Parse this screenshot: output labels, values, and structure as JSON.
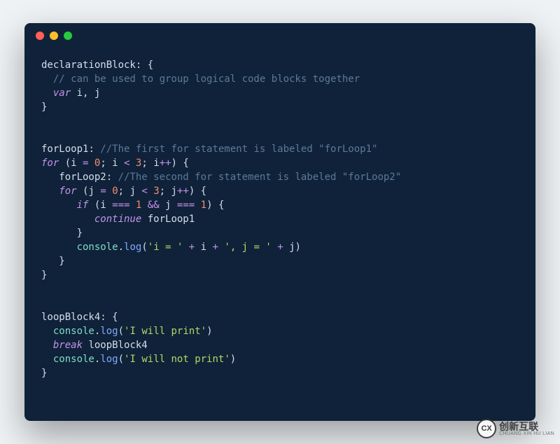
{
  "window": {
    "trafficLights": {
      "red": "#ff5f56",
      "yellow": "#ffbd2e",
      "green": "#27c93f"
    }
  },
  "code": {
    "lines": [
      [
        {
          "t": "declarationBlock",
          "c": "c-label"
        },
        {
          "t": ": {",
          "c": "c-punct"
        }
      ],
      [
        {
          "t": "  ",
          "c": "c-default"
        },
        {
          "t": "// can be used to group logical code blocks together",
          "c": "c-comment"
        }
      ],
      [
        {
          "t": "  ",
          "c": "c-default"
        },
        {
          "t": "var",
          "c": "c-var"
        },
        {
          "t": " i, j",
          "c": "c-default"
        }
      ],
      [
        {
          "t": "}",
          "c": "c-punct"
        }
      ],
      [],
      [],
      [
        {
          "t": "forLoop1",
          "c": "c-label"
        },
        {
          "t": ": ",
          "c": "c-punct"
        },
        {
          "t": "//The first for statement is labeled \"forLoop1\"",
          "c": "c-comment"
        }
      ],
      [
        {
          "t": "for",
          "c": "c-keyword"
        },
        {
          "t": " (i ",
          "c": "c-default"
        },
        {
          "t": "=",
          "c": "c-op"
        },
        {
          "t": " ",
          "c": "c-default"
        },
        {
          "t": "0",
          "c": "c-num"
        },
        {
          "t": "; i ",
          "c": "c-default"
        },
        {
          "t": "<",
          "c": "c-op"
        },
        {
          "t": " ",
          "c": "c-default"
        },
        {
          "t": "3",
          "c": "c-num"
        },
        {
          "t": "; i",
          "c": "c-default"
        },
        {
          "t": "++",
          "c": "c-op"
        },
        {
          "t": ") {",
          "c": "c-punct"
        }
      ],
      [
        {
          "t": "   forLoop2",
          "c": "c-label"
        },
        {
          "t": ": ",
          "c": "c-punct"
        },
        {
          "t": "//The second for statement is labeled \"forLoop2\"",
          "c": "c-comment"
        }
      ],
      [
        {
          "t": "   ",
          "c": "c-default"
        },
        {
          "t": "for",
          "c": "c-keyword"
        },
        {
          "t": " (j ",
          "c": "c-default"
        },
        {
          "t": "=",
          "c": "c-op"
        },
        {
          "t": " ",
          "c": "c-default"
        },
        {
          "t": "0",
          "c": "c-num"
        },
        {
          "t": "; j ",
          "c": "c-default"
        },
        {
          "t": "<",
          "c": "c-op"
        },
        {
          "t": " ",
          "c": "c-default"
        },
        {
          "t": "3",
          "c": "c-num"
        },
        {
          "t": "; j",
          "c": "c-default"
        },
        {
          "t": "++",
          "c": "c-op"
        },
        {
          "t": ") {",
          "c": "c-punct"
        }
      ],
      [
        {
          "t": "      ",
          "c": "c-default"
        },
        {
          "t": "if",
          "c": "c-keyword"
        },
        {
          "t": " (i ",
          "c": "c-default"
        },
        {
          "t": "===",
          "c": "c-op"
        },
        {
          "t": " ",
          "c": "c-default"
        },
        {
          "t": "1",
          "c": "c-num"
        },
        {
          "t": " ",
          "c": "c-default"
        },
        {
          "t": "&&",
          "c": "c-op"
        },
        {
          "t": " j ",
          "c": "c-default"
        },
        {
          "t": "===",
          "c": "c-op"
        },
        {
          "t": " ",
          "c": "c-default"
        },
        {
          "t": "1",
          "c": "c-num"
        },
        {
          "t": ") {",
          "c": "c-punct"
        }
      ],
      [
        {
          "t": "         ",
          "c": "c-default"
        },
        {
          "t": "continue",
          "c": "c-keyword"
        },
        {
          "t": " forLoop1",
          "c": "c-default"
        }
      ],
      [
        {
          "t": "      }",
          "c": "c-punct"
        }
      ],
      [
        {
          "t": "      ",
          "c": "c-default"
        },
        {
          "t": "console",
          "c": "c-obj"
        },
        {
          "t": ".",
          "c": "c-punct"
        },
        {
          "t": "log",
          "c": "c-func"
        },
        {
          "t": "(",
          "c": "c-punct"
        },
        {
          "t": "'i = '",
          "c": "c-str"
        },
        {
          "t": " ",
          "c": "c-default"
        },
        {
          "t": "+",
          "c": "c-op"
        },
        {
          "t": " i ",
          "c": "c-default"
        },
        {
          "t": "+",
          "c": "c-op"
        },
        {
          "t": " ",
          "c": "c-default"
        },
        {
          "t": "', j = '",
          "c": "c-str"
        },
        {
          "t": " ",
          "c": "c-default"
        },
        {
          "t": "+",
          "c": "c-op"
        },
        {
          "t": " j)",
          "c": "c-default"
        }
      ],
      [
        {
          "t": "   }",
          "c": "c-punct"
        }
      ],
      [
        {
          "t": "}",
          "c": "c-punct"
        }
      ],
      [],
      [],
      [
        {
          "t": "loopBlock4",
          "c": "c-label"
        },
        {
          "t": ": {",
          "c": "c-punct"
        }
      ],
      [
        {
          "t": "  ",
          "c": "c-default"
        },
        {
          "t": "console",
          "c": "c-obj"
        },
        {
          "t": ".",
          "c": "c-punct"
        },
        {
          "t": "log",
          "c": "c-func"
        },
        {
          "t": "(",
          "c": "c-punct"
        },
        {
          "t": "'I will print'",
          "c": "c-str"
        },
        {
          "t": ")",
          "c": "c-punct"
        }
      ],
      [
        {
          "t": "  ",
          "c": "c-default"
        },
        {
          "t": "break",
          "c": "c-keyword"
        },
        {
          "t": " loopBlock4",
          "c": "c-default"
        }
      ],
      [
        {
          "t": "  ",
          "c": "c-default"
        },
        {
          "t": "console",
          "c": "c-obj"
        },
        {
          "t": ".",
          "c": "c-punct"
        },
        {
          "t": "log",
          "c": "c-func"
        },
        {
          "t": "(",
          "c": "c-punct"
        },
        {
          "t": "'I will not print'",
          "c": "c-str"
        },
        {
          "t": ")",
          "c": "c-punct"
        }
      ],
      [
        {
          "t": "}",
          "c": "c-punct"
        }
      ]
    ]
  },
  "watermark": {
    "logo": "CX",
    "zh": "创新互联",
    "en": "CHUANG XIN HU LIAN"
  }
}
